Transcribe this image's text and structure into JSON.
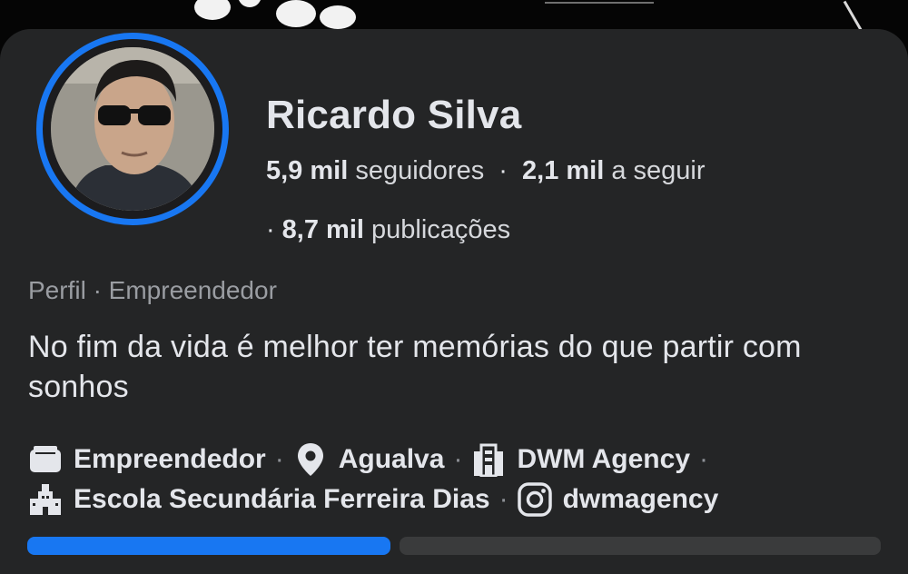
{
  "profile": {
    "name": "Ricardo Silva",
    "followers_count": "5,9 mil",
    "followers_label": "seguidores",
    "following_count": "2,1 mil",
    "following_label": "a seguir",
    "posts_count": "8,7 mil",
    "posts_label": "publicações",
    "category": "Perfil · Empreendedor",
    "bio": "No fim da vida é melhor ter memórias do que partir com sonhos"
  },
  "details": {
    "occupation": {
      "icon": "briefcase-icon",
      "text": "Empreendedor"
    },
    "location": {
      "icon": "location-pin-icon",
      "text": "Agualva"
    },
    "workplace": {
      "icon": "building-icon",
      "text": "DWM Agency"
    },
    "education": {
      "icon": "school-icon",
      "text": "Escola Secundária Ferreira Dias"
    },
    "instagram": {
      "icon": "instagram-icon",
      "text": "dwmagency"
    }
  },
  "separators": {
    "dot": "·"
  },
  "colors": {
    "background": "#242526",
    "accent": "#1877f2",
    "text_primary": "#e4e6eb",
    "text_secondary": "#9a9da2"
  }
}
